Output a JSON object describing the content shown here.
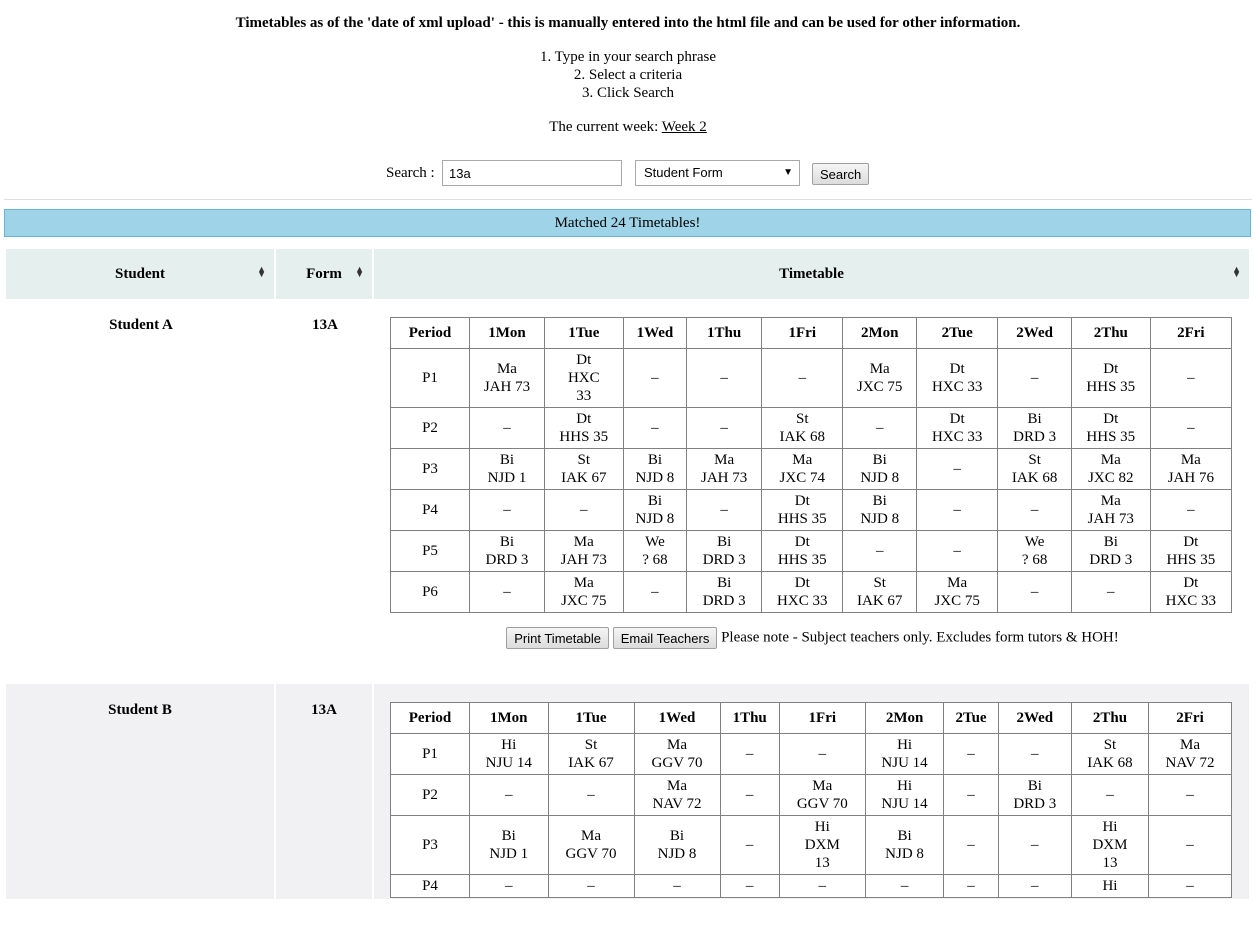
{
  "header": {
    "title": "Timetables as of the 'date of xml upload' - this is manually entered into the html file and can be used for other information."
  },
  "instructions": [
    "1. Type in your search phrase",
    "2. Select a criteria",
    "3. Click Search"
  ],
  "current_week": {
    "label": "The current week:",
    "link": "Week 2"
  },
  "search": {
    "label": "Search :",
    "value": "13a",
    "criteria": "Student Form",
    "button": "Search"
  },
  "matched": "Matched 24 Timetables!",
  "columns": {
    "student": "Student",
    "form": "Form",
    "timetable": "Timetable"
  },
  "days": [
    "1Mon",
    "1Tue",
    "1Wed",
    "1Thu",
    "1Fri",
    "2Mon",
    "2Tue",
    "2Wed",
    "2Thu",
    "2Fri"
  ],
  "period_label": "Period",
  "actions": {
    "print": "Print Timetable",
    "email": "Email Teachers",
    "note": "Please note - Subject teachers only. Excludes form tutors & HOH!"
  },
  "students": [
    {
      "name": "Student A",
      "form": "13A",
      "rows": [
        {
          "period": "P1",
          "cells": [
            "Ma\nJAH 73",
            "Dt\nHXC\n33",
            "–",
            "–",
            "–",
            "Ma\nJXC 75",
            "Dt\nHXC 33",
            "–",
            "Dt\nHHS 35",
            "–"
          ]
        },
        {
          "period": "P2",
          "cells": [
            "–",
            "Dt\nHHS 35",
            "–",
            "–",
            "St\nIAK 68",
            "–",
            "Dt\nHXC 33",
            "Bi\nDRD 3",
            "Dt\nHHS 35",
            "–"
          ]
        },
        {
          "period": "P3",
          "cells": [
            "Bi\nNJD 1",
            "St\nIAK 67",
            "Bi\nNJD 8",
            "Ma\nJAH 73",
            "Ma\nJXC 74",
            "Bi\nNJD 8",
            "–",
            "St\nIAK 68",
            "Ma\nJXC 82",
            "Ma\nJAH 76"
          ]
        },
        {
          "period": "P4",
          "cells": [
            "–",
            "–",
            "Bi\nNJD 8",
            "–",
            "Dt\nHHS 35",
            "Bi\nNJD 8",
            "–",
            "–",
            "Ma\nJAH 73",
            "–"
          ]
        },
        {
          "period": "P5",
          "cells": [
            "Bi\nDRD 3",
            "Ma\nJAH 73",
            "We\n? 68",
            "Bi\nDRD 3",
            "Dt\nHHS 35",
            "–",
            "–",
            "We\n? 68",
            "Bi\nDRD 3",
            "Dt\nHHS 35"
          ]
        },
        {
          "period": "P6",
          "cells": [
            "–",
            "Ma\nJXC 75",
            "–",
            "Bi\nDRD 3",
            "Dt\nHXC 33",
            "St\nIAK 67",
            "Ma\nJXC 75",
            "–",
            "–",
            "Dt\nHXC 33"
          ]
        }
      ]
    },
    {
      "name": "Student B",
      "form": "13A",
      "rows": [
        {
          "period": "P1",
          "cells": [
            "Hi\nNJU 14",
            "St\nIAK 67",
            "Ma\nGGV 70",
            "–",
            "–",
            "Hi\nNJU 14",
            "–",
            "–",
            "St\nIAK 68",
            "Ma\nNAV 72"
          ]
        },
        {
          "period": "P2",
          "cells": [
            "–",
            "–",
            "Ma\nNAV 72",
            "–",
            "Ma\nGGV 70",
            "Hi\nNJU 14",
            "–",
            "Bi\nDRD 3",
            "–",
            "–"
          ]
        },
        {
          "period": "P3",
          "cells": [
            "Bi\nNJD 1",
            "Ma\nGGV 70",
            "Bi\nNJD 8",
            "–",
            "Hi\nDXM\n13",
            "Bi\nNJD 8",
            "–",
            "–",
            "Hi\nDXM\n13",
            "–"
          ]
        },
        {
          "period": "P4",
          "cells": [
            "–",
            "–",
            "–",
            "–",
            "–",
            "–",
            "–",
            "–",
            "Hi",
            "–"
          ]
        }
      ]
    }
  ]
}
